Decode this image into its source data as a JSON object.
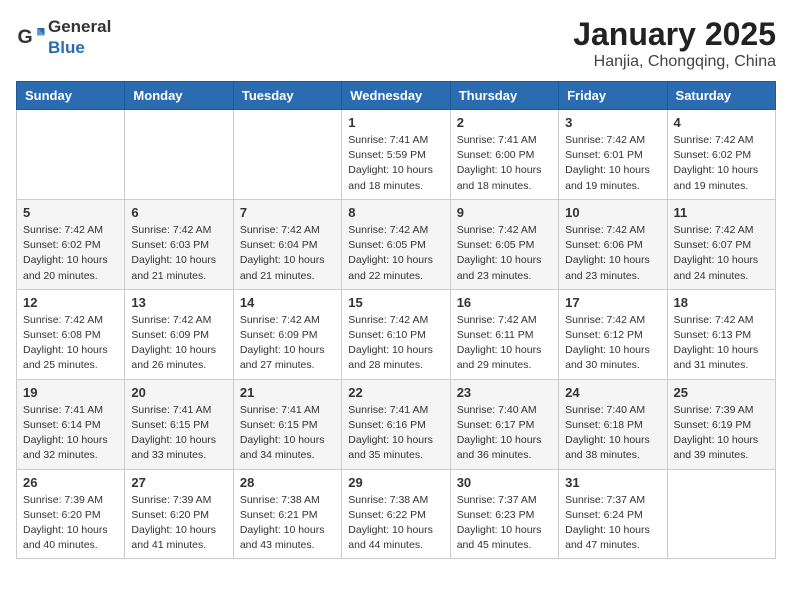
{
  "header": {
    "logo_general": "General",
    "logo_blue": "Blue",
    "title": "January 2025",
    "subtitle": "Hanjia, Chongqing, China"
  },
  "weekdays": [
    "Sunday",
    "Monday",
    "Tuesday",
    "Wednesday",
    "Thursday",
    "Friday",
    "Saturday"
  ],
  "weeks": [
    [
      {
        "day": "",
        "info": ""
      },
      {
        "day": "",
        "info": ""
      },
      {
        "day": "",
        "info": ""
      },
      {
        "day": "1",
        "info": "Sunrise: 7:41 AM\nSunset: 5:59 PM\nDaylight: 10 hours and 18 minutes."
      },
      {
        "day": "2",
        "info": "Sunrise: 7:41 AM\nSunset: 6:00 PM\nDaylight: 10 hours and 18 minutes."
      },
      {
        "day": "3",
        "info": "Sunrise: 7:42 AM\nSunset: 6:01 PM\nDaylight: 10 hours and 19 minutes."
      },
      {
        "day": "4",
        "info": "Sunrise: 7:42 AM\nSunset: 6:02 PM\nDaylight: 10 hours and 19 minutes."
      }
    ],
    [
      {
        "day": "5",
        "info": "Sunrise: 7:42 AM\nSunset: 6:02 PM\nDaylight: 10 hours and 20 minutes."
      },
      {
        "day": "6",
        "info": "Sunrise: 7:42 AM\nSunset: 6:03 PM\nDaylight: 10 hours and 21 minutes."
      },
      {
        "day": "7",
        "info": "Sunrise: 7:42 AM\nSunset: 6:04 PM\nDaylight: 10 hours and 21 minutes."
      },
      {
        "day": "8",
        "info": "Sunrise: 7:42 AM\nSunset: 6:05 PM\nDaylight: 10 hours and 22 minutes."
      },
      {
        "day": "9",
        "info": "Sunrise: 7:42 AM\nSunset: 6:05 PM\nDaylight: 10 hours and 23 minutes."
      },
      {
        "day": "10",
        "info": "Sunrise: 7:42 AM\nSunset: 6:06 PM\nDaylight: 10 hours and 23 minutes."
      },
      {
        "day": "11",
        "info": "Sunrise: 7:42 AM\nSunset: 6:07 PM\nDaylight: 10 hours and 24 minutes."
      }
    ],
    [
      {
        "day": "12",
        "info": "Sunrise: 7:42 AM\nSunset: 6:08 PM\nDaylight: 10 hours and 25 minutes."
      },
      {
        "day": "13",
        "info": "Sunrise: 7:42 AM\nSunset: 6:09 PM\nDaylight: 10 hours and 26 minutes."
      },
      {
        "day": "14",
        "info": "Sunrise: 7:42 AM\nSunset: 6:09 PM\nDaylight: 10 hours and 27 minutes."
      },
      {
        "day": "15",
        "info": "Sunrise: 7:42 AM\nSunset: 6:10 PM\nDaylight: 10 hours and 28 minutes."
      },
      {
        "day": "16",
        "info": "Sunrise: 7:42 AM\nSunset: 6:11 PM\nDaylight: 10 hours and 29 minutes."
      },
      {
        "day": "17",
        "info": "Sunrise: 7:42 AM\nSunset: 6:12 PM\nDaylight: 10 hours and 30 minutes."
      },
      {
        "day": "18",
        "info": "Sunrise: 7:42 AM\nSunset: 6:13 PM\nDaylight: 10 hours and 31 minutes."
      }
    ],
    [
      {
        "day": "19",
        "info": "Sunrise: 7:41 AM\nSunset: 6:14 PM\nDaylight: 10 hours and 32 minutes."
      },
      {
        "day": "20",
        "info": "Sunrise: 7:41 AM\nSunset: 6:15 PM\nDaylight: 10 hours and 33 minutes."
      },
      {
        "day": "21",
        "info": "Sunrise: 7:41 AM\nSunset: 6:15 PM\nDaylight: 10 hours and 34 minutes."
      },
      {
        "day": "22",
        "info": "Sunrise: 7:41 AM\nSunset: 6:16 PM\nDaylight: 10 hours and 35 minutes."
      },
      {
        "day": "23",
        "info": "Sunrise: 7:40 AM\nSunset: 6:17 PM\nDaylight: 10 hours and 36 minutes."
      },
      {
        "day": "24",
        "info": "Sunrise: 7:40 AM\nSunset: 6:18 PM\nDaylight: 10 hours and 38 minutes."
      },
      {
        "day": "25",
        "info": "Sunrise: 7:39 AM\nSunset: 6:19 PM\nDaylight: 10 hours and 39 minutes."
      }
    ],
    [
      {
        "day": "26",
        "info": "Sunrise: 7:39 AM\nSunset: 6:20 PM\nDaylight: 10 hours and 40 minutes."
      },
      {
        "day": "27",
        "info": "Sunrise: 7:39 AM\nSunset: 6:20 PM\nDaylight: 10 hours and 41 minutes."
      },
      {
        "day": "28",
        "info": "Sunrise: 7:38 AM\nSunset: 6:21 PM\nDaylight: 10 hours and 43 minutes."
      },
      {
        "day": "29",
        "info": "Sunrise: 7:38 AM\nSunset: 6:22 PM\nDaylight: 10 hours and 44 minutes."
      },
      {
        "day": "30",
        "info": "Sunrise: 7:37 AM\nSunset: 6:23 PM\nDaylight: 10 hours and 45 minutes."
      },
      {
        "day": "31",
        "info": "Sunrise: 7:37 AM\nSunset: 6:24 PM\nDaylight: 10 hours and 47 minutes."
      },
      {
        "day": "",
        "info": ""
      }
    ]
  ]
}
